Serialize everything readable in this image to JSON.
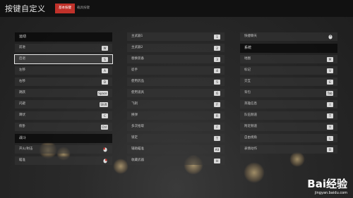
{
  "header": {
    "title": "按键自定义",
    "tabs": [
      {
        "label": "基本按键",
        "active": true
      },
      {
        "label": "载具按键",
        "active": false
      }
    ]
  },
  "columns": [
    {
      "sections": [
        {
          "title": "运动",
          "rows": [
            {
              "label": "前进",
              "key": "W"
            },
            {
              "label": "后退",
              "key": "S",
              "selected": true
            },
            {
              "label": "左移",
              "key": "A"
            },
            {
              "label": "右移",
              "key": "D"
            },
            {
              "label": "跳跃",
              "key": "Space"
            },
            {
              "label": "闪避",
              "key": "Shift"
            },
            {
              "label": "蹲伏",
              "key": "C"
            },
            {
              "label": "俯卧",
              "key": "Ctrl"
            }
          ]
        },
        {
          "title": "战斗",
          "rows": [
            {
              "label": "开火/射击",
              "key": "mouse-left-icon"
            },
            {
              "label": "瞄准",
              "key": "mouse-right-icon"
            }
          ]
        }
      ]
    },
    {
      "sections": [
        {
          "title": "",
          "rows": [
            {
              "label": "主武器1",
              "key": "1"
            },
            {
              "label": "主武器2",
              "key": "2"
            },
            {
              "label": "替换装备",
              "key": "3"
            },
            {
              "label": "徒手",
              "key": "4"
            },
            {
              "label": "使用药品",
              "key": "5"
            },
            {
              "label": "使用道具",
              "key": "6"
            },
            {
              "label": "飞刺",
              "key": "F"
            },
            {
              "label": "换弹",
              "key": "R"
            },
            {
              "label": "多次拾取",
              "key": "F"
            },
            {
              "label": "锁定",
              "key": "T"
            },
            {
              "label": "辅助瞄准",
              "key": "Alt"
            },
            {
              "label": "收藏武器",
              "key": "H"
            }
          ]
        }
      ]
    },
    {
      "sections": [
        {
          "title": "",
          "rows": [
            {
              "label": "快捷聊天",
              "key": "mouse-icon"
            }
          ]
        },
        {
          "title": "系统",
          "rows": [
            {
              "label": "地图",
              "key": "M"
            },
            {
              "label": "标记",
              "key": "V"
            },
            {
              "label": "交互",
              "key": "E"
            },
            {
              "label": "背包",
              "key": "Tab"
            },
            {
              "label": "英雄信息",
              "key": "I"
            },
            {
              "label": "队伍频道",
              "key": "T"
            },
            {
              "label": "附近频道",
              "key": "Y"
            },
            {
              "label": "自由视角",
              "key": "L"
            },
            {
              "label": "表情动作",
              "key": "B"
            }
          ]
        }
      ]
    }
  ],
  "watermark": {
    "logo": "Bai经验",
    "url": "jingyan.baidu.com"
  }
}
